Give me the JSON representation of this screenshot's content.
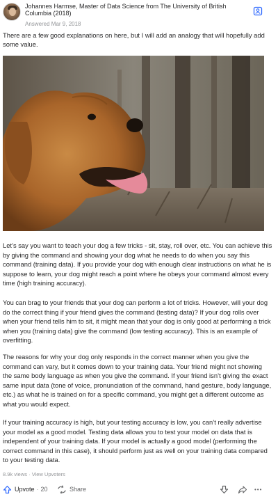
{
  "answer": {
    "author_line": "Johannes Harmse, Master of Data Science from The University of British Columbia (2018)",
    "answered": "Answered Mar 9, 2018",
    "intro": "There are a few good explanations on here, but I will add an analogy that will hopefully add some value.",
    "paragraphs": [
      "Let’s say you want to teach your dog a few tricks - sit, stay, roll over, etc. You can achieve this by giving the command and showing your dog what he needs to do when you say this command (training data). If you provide your dog with enough clear instructions on what he is suppose to learn, your dog might reach a point where he obeys your command almost every time (high training accuracy).",
      "You can brag to your friends that your dog can perform a lot of tricks. However, will your dog do the correct thing if your friend gives the command (testing data)? If your dog rolls over when your friend tells him to sit, it might mean that your dog is only good at performing a trick when you (training data) give the command (low testing accuracy). This is an example of overfitting.",
      "The reasons for why your dog only responds in the correct manner when you give the command can vary, but it comes down to your training data. Your friend might not showing the same body language as when you give the command. If your friend isn’t giving the exact same input data (tone of voice, pronunciation of the command, hand gesture, body language, etc.) as what he is trained on for a specific command, you might get a different outcome as what you would expect.",
      "If your training accuracy is high, but your testing accuracy is low, you can’t really advertise your model as a good model. Testing data allows you to test your model on data that is independent of your training data. If your model is actually a good model (performing the correct command in this case), it should perform just as well on your training data compared to your testing data."
    ],
    "views": "8.9k views",
    "separator": "·",
    "view_upvoters": "View Upvoters"
  },
  "actions": {
    "upvote_label": "Upvote",
    "upvote_sep": "·",
    "upvote_count": "20",
    "share_label": "Share",
    "more_label": "•••"
  },
  "icons": {
    "follow": "follow-person-icon",
    "upvote": "upvote-arrow-icon",
    "share": "share-icon",
    "downvote": "downvote-arrow-icon",
    "forward": "forward-arrow-icon",
    "more": "more-dots-icon"
  },
  "colors": {
    "accent_blue": "#2e69ff",
    "text": "#282829",
    "muted": "#939598"
  }
}
